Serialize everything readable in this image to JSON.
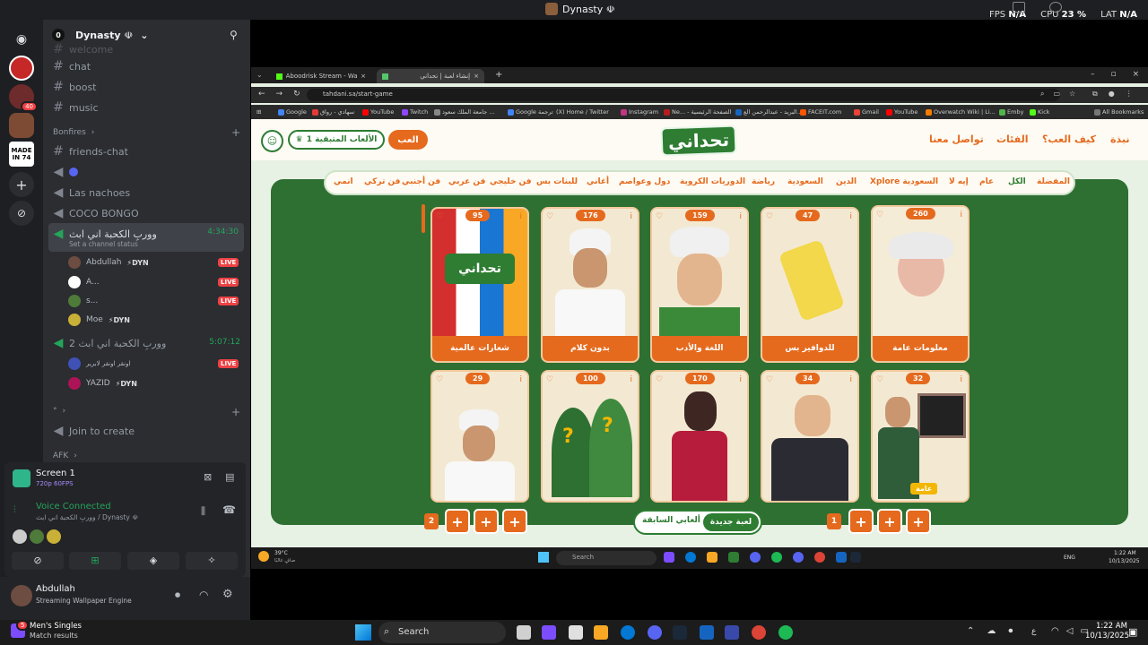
{
  "window": {
    "title": "Dynasty ☫"
  },
  "stats": {
    "fps_label": "FPS",
    "fps_value": "N/A",
    "cpu_label": "CPU",
    "cpu_value": "23 %",
    "lat_label": "LAT",
    "lat_value": "N/A"
  },
  "server": {
    "name": "Dynasty ☫",
    "count": "0"
  },
  "rail": {
    "badge": "40",
    "made_in": "MADE IN 74"
  },
  "channels": {
    "top_cut": "welcome",
    "text": [
      "chat",
      "boost",
      "music"
    ],
    "category": "Bonfires",
    "friends": "friends-chat",
    "voice1": "Las nachoes",
    "voice2": "COCO BONGO",
    "active": {
      "name": "ووربِ الكحبة اني ابث",
      "time": "4:34:30",
      "status": "Set a channel status"
    },
    "members1": [
      {
        "name": "Abdullah",
        "tag": "DYN",
        "live": "LIVE"
      },
      {
        "name": "A...",
        "live": "LIVE"
      },
      {
        "name": "s...",
        "live": "LIVE"
      },
      {
        "name": "Moe",
        "tag": "DYN"
      }
    ],
    "voice3": {
      "name": "ووربِ الكحبة اني ابث 2",
      "time": "5:07:12"
    },
    "members2": [
      {
        "name": "اونقر اونقر لابرير",
        "live": "LIVE"
      },
      {
        "name": "YAZID",
        "tag": "DYN"
      }
    ],
    "cat2": "°",
    "join": "Join to create",
    "afk": "AFK"
  },
  "screen": {
    "title": "Screen 1",
    "quality": "720p 60FPS"
  },
  "voice": {
    "status": "Voice Connected",
    "channel": "ووربِ الكحبة اني ابث / Dynasty ☫"
  },
  "user": {
    "name": "Abdullah",
    "activity": "Streaming Wallpaper Engine"
  },
  "browser": {
    "tabs": [
      "Aboodrisk Stream - Watch Live",
      "إنشاء لعبة | تحداني"
    ],
    "url": "tahdani.sa/start-game",
    "bookmarks": [
      "Google",
      "سهادي - رواق",
      "YouTube",
      "Twitch",
      "جامعة الملك سعود ...",
      "Google ترجمة",
      "(X) Home / Twitter",
      "Instagram",
      "Ne... - الصفحة الرئيسية",
      "البريد - عبدالرحمن الع...",
      "FACEIT.com",
      "Gmail",
      "YouTube",
      "Overwatch Wiki | Li...",
      "Emby",
      "Kick",
      "All Bookmarks"
    ]
  },
  "site": {
    "logo": "تحداني",
    "nav": [
      "نبذة",
      "كيف العب؟",
      "الفئات",
      "تواصل معنا"
    ],
    "play": "العب",
    "remaining": "الألعاب المتبقية 1",
    "categories": [
      "المفضلة",
      "الكل",
      "عام",
      "إيه لا",
      "Xplore السعودية",
      "الدين",
      "السعودية",
      "رياضة",
      "الدوريات الكروية",
      "دول وعواصم",
      "أغاني",
      "للبنات بس",
      "فن خليجي",
      "فن عربي",
      "فن أجنبي",
      "فن تركي",
      "انمي"
    ],
    "cards_row1": [
      {
        "label": "معلومات عامة",
        "count": "260"
      },
      {
        "label": "للدوافير بس",
        "count": "47"
      },
      {
        "label": "اللغة والأدب",
        "count": "159"
      },
      {
        "label": "بدون كلام",
        "count": "176"
      },
      {
        "label": "شعارات عالمية",
        "count": "95"
      }
    ],
    "cards_row2": [
      {
        "label": "عامة",
        "count": "32"
      },
      {
        "label": "",
        "count": "34"
      },
      {
        "label": "",
        "count": "170"
      },
      {
        "label": "",
        "count": "100"
      },
      {
        "label": "",
        "count": "29"
      }
    ],
    "page_left": "1",
    "page_right": "2",
    "new_game": "لعبة جديدة",
    "prev_games": "ألعابي السابقة",
    "plus": "+"
  },
  "inner_taskbar": {
    "weather": "39°C",
    "weather_sub": "صافٍ غالبًا",
    "search": "Search",
    "lang": "ENG",
    "time": "1:22 AM",
    "date": "10/13/2025"
  },
  "taskbar": {
    "notif_title": "Men's Singles",
    "notif_sub": "Match results",
    "search": "Search",
    "lang": "ع",
    "time": "1:22 AM",
    "date": "10/13/2025",
    "badge": "5"
  }
}
